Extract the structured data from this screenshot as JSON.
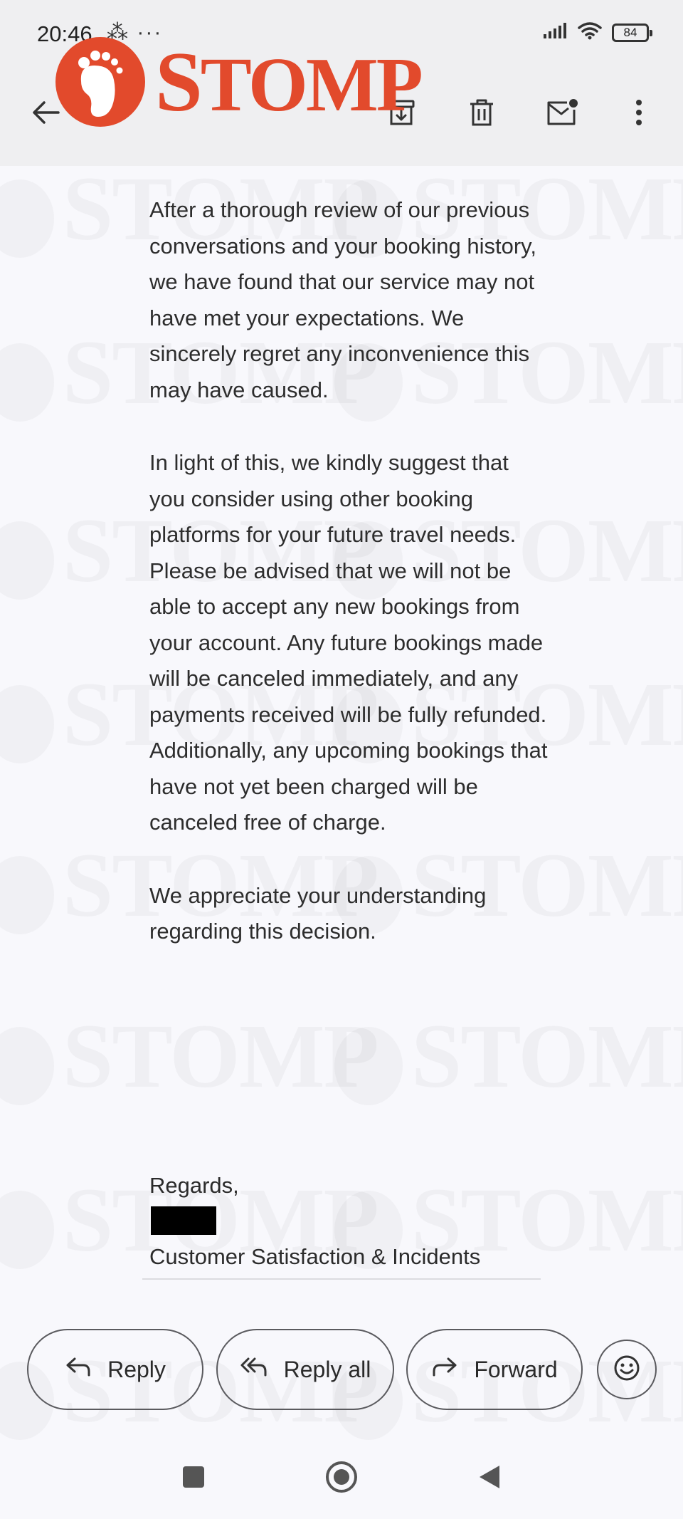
{
  "status_bar": {
    "time": "20:46",
    "extra_icons": "⁂ ···",
    "battery": "84"
  },
  "toolbar": {
    "back_icon": "back-arrow-icon",
    "archive_icon": "archive-icon",
    "delete_icon": "trash-icon",
    "mark_unread_icon": "mail-unread-icon",
    "more_icon": "more-vertical-icon"
  },
  "logo": {
    "text_first": "S",
    "text_rest": "TOMP",
    "color": "#e24a2c"
  },
  "watermark": {
    "text": "STOMP"
  },
  "email": {
    "paragraphs": [
      "After a thorough review of our previous conversations and your booking history, we have found that our service may not have met your expectations. We sincerely regret any inconvenience this may have caused.",
      "In light of this, we kindly suggest that you consider using other booking platforms for your future travel needs. Please be advised that we will not be able to accept any new bookings from your account. Any future bookings made will be canceled immediately, and any payments received will be fully refunded. Additionally, any upcoming bookings that have not yet been charged will be canceled free of charge.",
      "We appreciate your understanding regarding this decision."
    ],
    "closing": "Regards,",
    "signature": "Customer Satisfaction & Incidents"
  },
  "actions": {
    "reply": "Reply",
    "reply_all": "Reply all",
    "forward": "Forward",
    "emoji_icon": "emoji-reaction-icon"
  },
  "nav": {
    "recents_icon": "square-recents-icon",
    "home_icon": "circle-home-icon",
    "back_icon": "triangle-back-icon"
  }
}
